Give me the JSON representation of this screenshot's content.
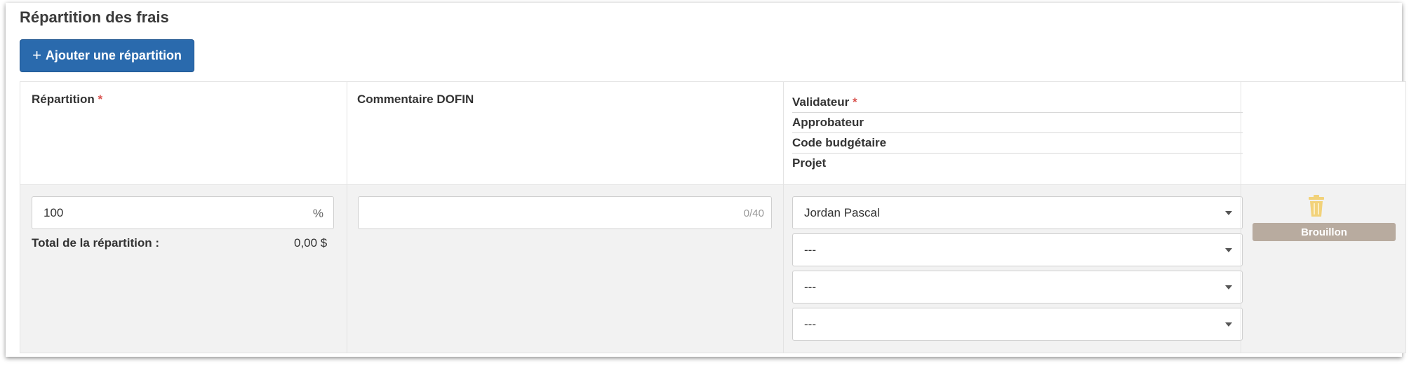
{
  "section": {
    "title": "Répartition des frais"
  },
  "toolbar": {
    "add_icon": "+",
    "add_label": "Ajouter une répartition"
  },
  "headers": {
    "repartition": "Répartition",
    "required_mark": "*",
    "commentaire": "Commentaire DOFIN",
    "validateur": "Validateur",
    "approbateur": "Approbateur",
    "code_budgetaire": "Code budgétaire",
    "projet": "Projet"
  },
  "row": {
    "repartition_value": "100",
    "percent_suffix": "%",
    "total_label": "Total de la répartition :",
    "total_value": "0,00 $",
    "comment_value": "",
    "comment_counter": "0/40",
    "validateur_value": "Jordan Pascal",
    "approbateur_value": "---",
    "code_budgetaire_value": "---",
    "projet_value": "---",
    "status_badge": "Brouillon"
  },
  "icons": {
    "add": "plus-icon",
    "delete": "trash-icon",
    "dropdown": "chevron-down-icon"
  },
  "colors": {
    "primary_button": "#2a6aad",
    "required": "#d9534f",
    "trash_icon": "#f2d27a",
    "status_badge": "#b8ab9f",
    "row_background": "#f2f2f2"
  }
}
